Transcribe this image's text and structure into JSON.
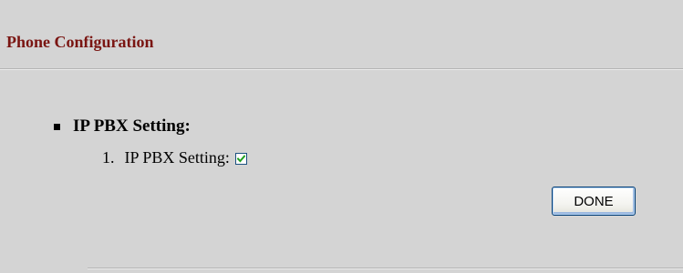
{
  "header": {
    "title": "Phone Configuration"
  },
  "section": {
    "title": "IP PBX Setting:",
    "items": [
      {
        "number": "1.",
        "label": "IP PBX Setting:",
        "checked": true
      }
    ]
  },
  "actions": {
    "done_label": "DONE"
  },
  "colors": {
    "title": "#7a1512",
    "background": "#d4d4d4",
    "checkmark": "#21a121"
  },
  "icons": {
    "bullet": "square-bullet-icon",
    "check": "checkmark-icon"
  }
}
